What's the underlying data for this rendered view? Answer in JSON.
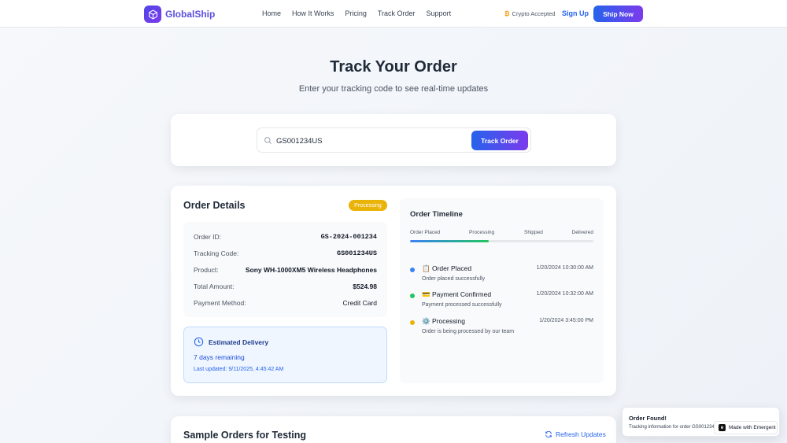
{
  "header": {
    "brand": "GlobalShip",
    "nav": [
      "Home",
      "How It Works",
      "Pricing",
      "Track Order",
      "Support"
    ],
    "crypto_symbol": "₿",
    "crypto_text": "Crypto Accepted",
    "signup_label": "Sign Up",
    "shipnow_label": "Ship Now"
  },
  "hero": {
    "title": "Track Your Order",
    "subtitle": "Enter your tracking code to see real-time updates"
  },
  "search": {
    "value": "GS001234US",
    "button_label": "Track Order"
  },
  "order": {
    "title": "Order Details",
    "status_badge": "Processing",
    "status_color": "#eab308",
    "rows": [
      {
        "label": "Order ID:",
        "value": "GS-2024-001234"
      },
      {
        "label": "Tracking Code:",
        "value": "GS001234US"
      },
      {
        "label": "Product:",
        "value": "Sony WH-1000XM5 Wireless Headphones"
      },
      {
        "label": "Total Amount:",
        "value": "$524.98"
      },
      {
        "label": "Payment Method:",
        "value": "Credit Card"
      }
    ],
    "estimate": {
      "title": "Estimated Delivery",
      "days": "7 days remaining",
      "updated": "Last updated: 9/11/2025, 4:45:42 AM"
    }
  },
  "timeline": {
    "title": "Order Timeline",
    "stages": [
      "Order Placed",
      "Processing",
      "Shipped",
      "Delivered"
    ],
    "progress": 0.43,
    "events": [
      {
        "icon": "📋",
        "title": "Order Placed",
        "time": "1/20/2024 10:30:00 AM",
        "desc": "Order placed successfully",
        "color": "#3b82f6"
      },
      {
        "icon": "💳",
        "title": "Payment Confirmed",
        "time": "1/20/2024 10:32:00 AM",
        "desc": "Payment processed successfully",
        "color": "#22c55e"
      },
      {
        "icon": "⚙️",
        "title": "Processing",
        "time": "1/20/2024 3:45:00 PM",
        "desc": "Order is being processed by our team",
        "color": "#eab308"
      }
    ]
  },
  "samples": {
    "title": "Sample Orders for Testing",
    "refresh_label": "Refresh Updates"
  },
  "toast": {
    "title": "Order Found!",
    "message": "Tracking information for order GS001234US"
  },
  "badge": {
    "label": "Made with Emergent"
  }
}
